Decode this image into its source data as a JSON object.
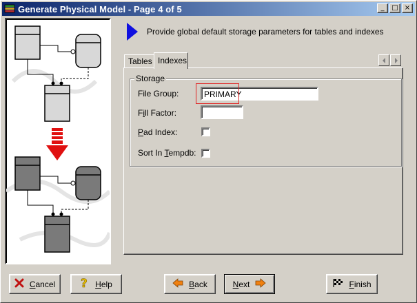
{
  "window": {
    "title": "Generate Physical Model - Page 4 of 5",
    "controls": {
      "minimize": "_",
      "maximize": "□",
      "close": "×"
    }
  },
  "header": {
    "text": "Provide global default storage parameters for tables and indexes"
  },
  "tabs": [
    {
      "label": "Tables",
      "active": false
    },
    {
      "label": "Indexes",
      "active": true
    }
  ],
  "storage": {
    "group_label": "Storage",
    "file_group": {
      "label_pre": "File Group:",
      "value": "PRIMARY"
    },
    "fill_factor": {
      "label_first": "F",
      "label_ul": "i",
      "label_rest": "ll Factor:",
      "value": ""
    },
    "pad_index": {
      "label_ul": "P",
      "label_rest": "ad Index:",
      "checked": false
    },
    "sort_in_tempdb": {
      "label_pre": "Sort In ",
      "label_ul": "T",
      "label_rest": "empdb:",
      "checked": false
    }
  },
  "buttons": {
    "cancel": {
      "ul": "C",
      "rest": "ancel",
      "icon": "x-icon"
    },
    "help": {
      "ul": "H",
      "rest": "elp",
      "icon": "question-icon"
    },
    "back": {
      "ul": "B",
      "rest": "ack",
      "icon": "left-arrow-icon"
    },
    "next": {
      "ul": "N",
      "rest": "ext",
      "icon": "right-arrow-icon"
    },
    "finish": {
      "ul": "F",
      "rest": "inish",
      "icon": "checkered-flag-icon"
    }
  },
  "colors": {
    "titlebar_start": "#0a246a",
    "titlebar_end": "#a6caf0",
    "header_arrow": "#1010e0",
    "highlight_box": "#e02020",
    "nav_arrow": "#f08010"
  }
}
